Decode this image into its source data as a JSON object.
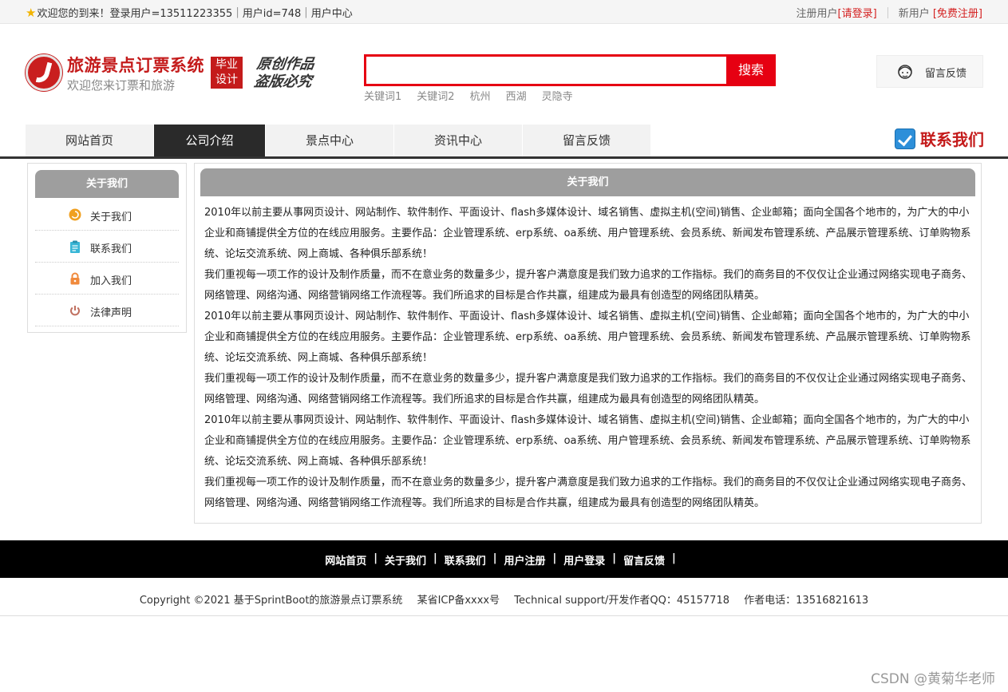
{
  "topbar": {
    "welcome": "欢迎您的到来！登录用户=13511223355",
    "user_id": "用户id=748",
    "user_center": "用户中心",
    "register_label": "注册用户",
    "login_link": "[请登录]",
    "new_user_label": "新用户",
    "free_register_link": "[免费注册]"
  },
  "header": {
    "site_title": "旅游景点订票系统",
    "site_subtitle": "欢迎您来订票和旅游",
    "badge_line1": "毕业",
    "badge_line2": "设计",
    "slogan_line1": "原创作品",
    "slogan_line2": "盗版必究"
  },
  "search": {
    "value": "",
    "button_label": "搜索",
    "hot_words": [
      "关键词1",
      "关键词2",
      "杭州",
      "西湖",
      "灵隐寺"
    ]
  },
  "message_box": {
    "label": "留言反馈"
  },
  "nav": {
    "items": [
      {
        "label": "网站首页",
        "active": false
      },
      {
        "label": "公司介绍",
        "active": true
      },
      {
        "label": "景点中心",
        "active": false
      },
      {
        "label": "资讯中心",
        "active": false
      },
      {
        "label": "留言反馈",
        "active": false
      }
    ],
    "contact_us": "联系我们"
  },
  "sidebar": {
    "title": "关于我们",
    "items": [
      {
        "label": "关于我们",
        "icon": "info-icon",
        "color": "#f0a020"
      },
      {
        "label": "联系我们",
        "icon": "clipboard-icon",
        "color": "#38b6d6"
      },
      {
        "label": "加入我们",
        "icon": "lock-icon",
        "color": "#f08a3c"
      },
      {
        "label": "法律声明",
        "icon": "power-icon",
        "color": "#c07060"
      }
    ]
  },
  "main": {
    "title": "关于我们",
    "paragraphs": [
      "2010年以前主要从事网页设计、网站制作、软件制作、平面设计、flash多媒体设计、域名销售、虚拟主机(空间)销售、企业邮箱；面向全国各个地市的，为广大的中小企业和商铺提供全方位的在线应用服务。主要作品：企业管理系统、erp系统、oa系统、用户管理系统、会员系统、新闻发布管理系统、产品展示管理系统、订单购物系统、论坛交流系统、网上商城、各种俱乐部系统！",
      "我们重视每一项工作的设计及制作质量，而不在意业务的数量多少，提升客户满意度是我们致力追求的工作指标。我们的商务目的不仅仅让企业通过网络实现电子商务、网络管理、网络沟通、网络营销网络工作流程等。我们所追求的目标是合作共赢，组建成为最具有创造型的网络团队精英。",
      "2010年以前主要从事网页设计、网站制作、软件制作、平面设计、flash多媒体设计、域名销售、虚拟主机(空间)销售、企业邮箱；面向全国各个地市的，为广大的中小企业和商铺提供全方位的在线应用服务。主要作品：企业管理系统、erp系统、oa系统、用户管理系统、会员系统、新闻发布管理系统、产品展示管理系统、订单购物系统、论坛交流系统、网上商城、各种俱乐部系统！",
      "我们重视每一项工作的设计及制作质量，而不在意业务的数量多少，提升客户满意度是我们致力追求的工作指标。我们的商务目的不仅仅让企业通过网络实现电子商务、网络管理、网络沟通、网络营销网络工作流程等。我们所追求的目标是合作共赢，组建成为最具有创造型的网络团队精英。",
      "2010年以前主要从事网页设计、网站制作、软件制作、平面设计、flash多媒体设计、域名销售、虚拟主机(空间)销售、企业邮箱；面向全国各个地市的，为广大的中小企业和商铺提供全方位的在线应用服务。主要作品：企业管理系统、erp系统、oa系统、用户管理系统、会员系统、新闻发布管理系统、产品展示管理系统、订单购物系统、论坛交流系统、网上商城、各种俱乐部系统！",
      "我们重视每一项工作的设计及制作质量，而不在意业务的数量多少，提升客户满意度是我们致力追求的工作指标。我们的商务目的不仅仅让企业通过网络实现电子商务、网络管理、网络沟通、网络营销网络工作流程等。我们所追求的目标是合作共赢，组建成为最具有创造型的网络团队精英。"
    ]
  },
  "footer": {
    "links": [
      "网站首页",
      "关于我们",
      "联系我们",
      "用户注册",
      "用户登录",
      "留言反馈"
    ],
    "copyright": "Copyright ©2021 基于SprintBoot的旅游景点订票系统",
    "icp": "某省ICP备xxxx号",
    "support": "Technical support/开发作者QQ：45157718",
    "phone": "作者电话：13516821613"
  },
  "watermark": "CSDN @黄菊华老师",
  "colors": {
    "brand_red": "#c41b1b",
    "search_red": "#e60012",
    "nav_active": "#2a2a2a",
    "panel_header": "#9e9e9e",
    "footer_bg": "#000000"
  }
}
